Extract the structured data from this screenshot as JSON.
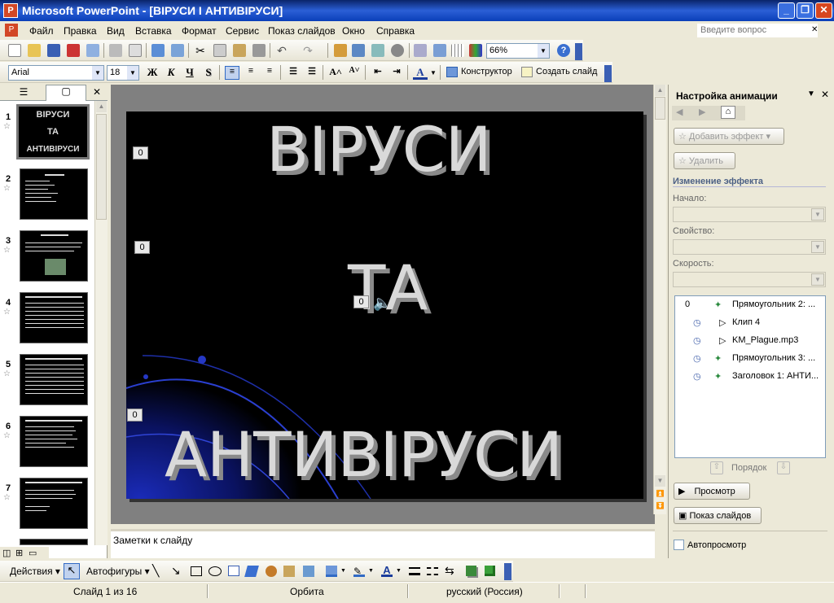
{
  "window": {
    "title": "Microsoft PowerPoint - [ВІРУСИ І АНТИВІРУСИ]"
  },
  "menu": [
    "Файл",
    "Правка",
    "Вид",
    "Вставка",
    "Формат",
    "Сервис",
    "Показ слайдов",
    "Окно",
    "Справка"
  ],
  "help_placeholder": "Введите вопрос",
  "standard_toolbar": {
    "zoom": "66%"
  },
  "format_toolbar": {
    "font": "Arial",
    "size": "18",
    "bold": "Ж",
    "italic": "К",
    "underline": "Ч",
    "shadow": "S",
    "designer": "Конструктор",
    "new_slide": "Создать слайд"
  },
  "slides": {
    "numbers": [
      "1",
      "2",
      "3",
      "4",
      "5",
      "6",
      "7"
    ],
    "thumb1_lines": [
      "ВІРУСИ",
      "ТА",
      "АНТИВІРУСИ"
    ]
  },
  "slide": {
    "line1": "ВІРУСИ",
    "line2": "ТА",
    "line3": "АНТИВІРУСИ",
    "tags": [
      "0",
      "0",
      "0",
      "0"
    ]
  },
  "notes_placeholder": "Заметки к слайду",
  "task_pane": {
    "title": "Настройка анимации",
    "add_effect": "Добавить эффект",
    "remove": "Удалить",
    "change_effect": "Изменение эффекта",
    "start_label": "Начало:",
    "property_label": "Свойство:",
    "speed_label": "Скорость:",
    "items": [
      {
        "index": "0",
        "name": "Прямоугольник 2: ..."
      },
      {
        "index": "",
        "name": "Клип 4"
      },
      {
        "index": "",
        "name": "KM_Plague.mp3"
      },
      {
        "index": "",
        "name": "Прямоугольник 3: ..."
      },
      {
        "index": "",
        "name": "Заголовок 1: АНТИ..."
      }
    ],
    "order_label": "Порядок",
    "preview": "Просмотр",
    "slideshow": "Показ слайдов",
    "autopreview": "Автопросмотр"
  },
  "drawing_toolbar": {
    "actions": "Действия",
    "autoshapes": "Автофигуры"
  },
  "status": {
    "slide": "Слайд 1 из 16",
    "design": "Орбита",
    "language": "русский (Россия)"
  }
}
